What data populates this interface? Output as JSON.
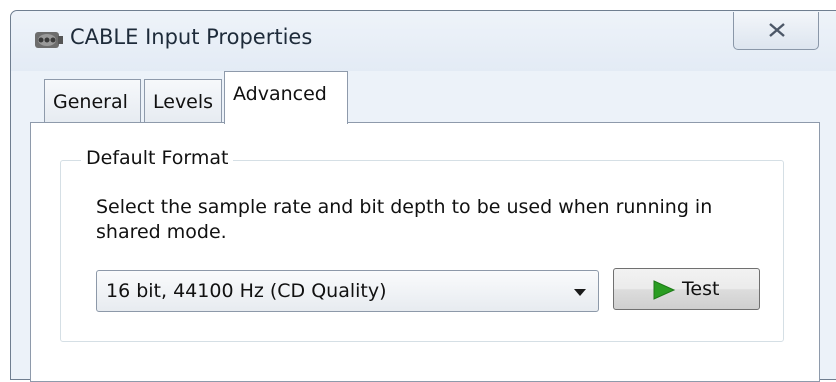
{
  "window": {
    "title": "CABLE Input Properties",
    "title_icon": "speaker-device-icon",
    "close_icon": "close-x-icon"
  },
  "tabs": [
    {
      "label": "General",
      "active": false
    },
    {
      "label": "Levels",
      "active": false
    },
    {
      "label": "Advanced",
      "active": true
    }
  ],
  "default_format": {
    "group_title": "Default Format",
    "description": "Select the sample rate and bit depth to be used when running in shared mode.",
    "selected_format": "16 bit, 44100 Hz (CD Quality)",
    "dropdown_icon": "chevron-down-icon",
    "test_label": "Test",
    "test_icon": "play-icon"
  },
  "colors": {
    "window_bg": "#ecf2f9",
    "panel_bg": "#ffffff",
    "play_green": "#2a9d22"
  }
}
